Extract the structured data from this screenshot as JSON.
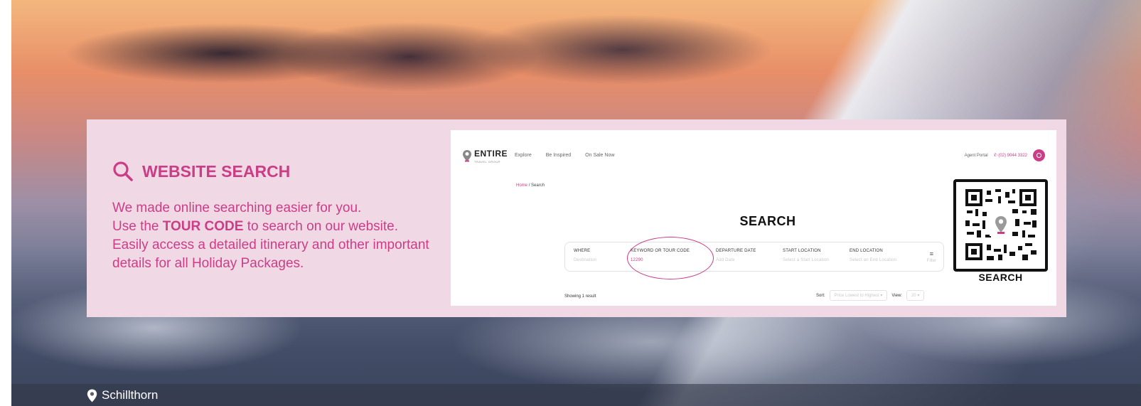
{
  "panel": {
    "title": "WEBSITE SEARCH",
    "line1": "We made online searching easier for you.",
    "line2_pre": "Use the ",
    "line2_bold": "TOUR CODE",
    "line2_post": " to search on our website.",
    "line3": "Easily access a detailed itinerary and other important details for all Holiday Packages.",
    "accent_color": "#cc3d88",
    "background_color": "#f0d9e5"
  },
  "screenshot": {
    "logo_text": "ENTIRE",
    "logo_sub": "TRAVEL GROUP",
    "nav_links": [
      "Explore",
      "Be Inspired",
      "On Sale Now"
    ],
    "agent_portal": "Agent Portal",
    "phone": "(02) 9044 3322",
    "breadcrumb_home": "Home",
    "breadcrumb_sep": "/",
    "breadcrumb_current": "Search",
    "heading": "SEARCH",
    "fields": [
      {
        "label": "WHERE",
        "placeholder": "Destination"
      },
      {
        "label": "KEYWORD OR TOUR CODE",
        "value": "12290"
      },
      {
        "label": "DEPARTURE DATE",
        "placeholder": "Add Date"
      },
      {
        "label": "START LOCATION",
        "placeholder": "Select a Start Location"
      },
      {
        "label": "END LOCATION",
        "placeholder": "Select an End Location"
      }
    ],
    "filter_label": "Filter",
    "showing": "Showing 1 result",
    "sort_label": "Sort:",
    "sort_value": "Price Lowest to Highest",
    "view_label": "View:",
    "view_value": "20"
  },
  "qr": {
    "label": "SEARCH",
    "icon": "qr-code-icon"
  },
  "caption": {
    "location": "Schillthorn",
    "icon": "map-pin-icon"
  }
}
